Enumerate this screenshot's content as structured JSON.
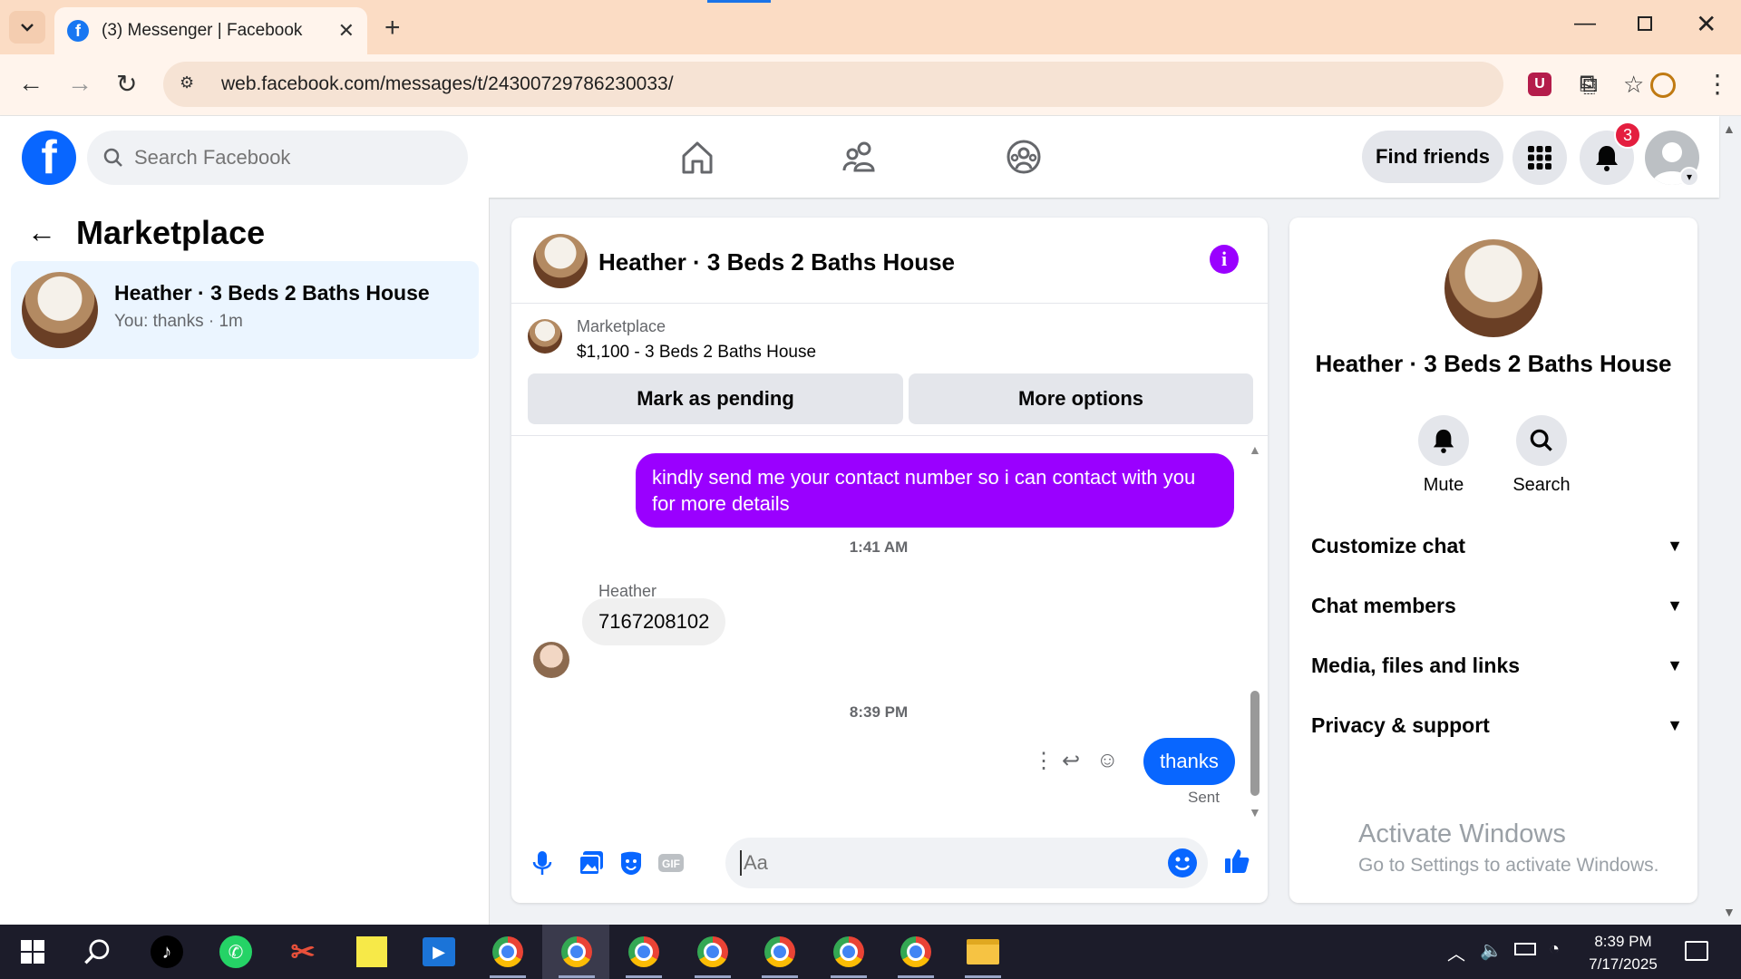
{
  "browser": {
    "tab_title": "(3) Messenger | Facebook",
    "url": "web.facebook.com/messages/t/24300729786230033/"
  },
  "fb_header": {
    "search_placeholder": "Search Facebook",
    "find_friends_label": "Find friends",
    "notification_count": "3"
  },
  "sidebar": {
    "title": "Marketplace",
    "conversation": {
      "name": "Heather · 3 Beds 2 Baths House",
      "preview": "You: thanks · 1m"
    }
  },
  "chat": {
    "title": "Heather · 3 Beds 2 Baths House",
    "listing": {
      "label": "Marketplace",
      "price_title": "$1,100 - 3 Beds 2 Baths House",
      "mark_pending_label": "Mark as pending",
      "more_options_label": "More options"
    },
    "messages": [
      {
        "from": "me",
        "text": "kindly send me your contact number so i can contact with you for more details"
      },
      {
        "from": "Heather",
        "text": "7167208102"
      },
      {
        "from": "me",
        "text": "thanks"
      }
    ],
    "time_1": "1:41 AM",
    "time_2": "8:39 PM",
    "sender_name": "Heather",
    "sent_status": "Sent",
    "composer_placeholder": "Aa"
  },
  "info_panel": {
    "name": "Heather · 3 Beds 2 Baths House",
    "mute_label": "Mute",
    "search_label": "Search",
    "sections": [
      "Customize chat",
      "Chat members",
      "Media, files and links",
      "Privacy & support"
    ]
  },
  "watermark": {
    "title": "Activate Windows",
    "subtitle": "Go to Settings to activate Windows."
  },
  "taskbar": {
    "time": "8:39 PM",
    "date": "7/17/2025"
  },
  "colors": {
    "accent_purple": "#9a00ff",
    "fb_blue": "#0866ff",
    "badge_red": "#e41e3f"
  }
}
